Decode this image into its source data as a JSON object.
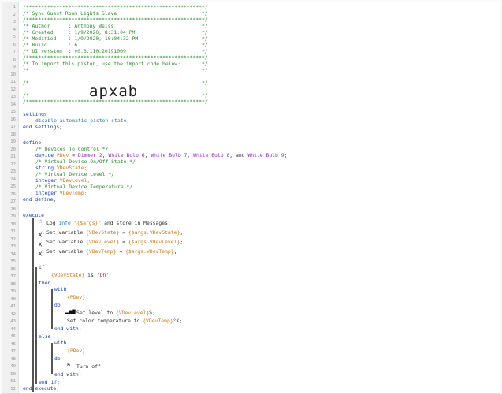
{
  "code": {
    "header": [
      "/***********************************************************/",
      "/* Sync Guest Room Lights Slave                            */",
      "/***********************************************************/",
      "/* Author      : Anthony Weiss                             */",
      "/* Created     : 1/9/2020, 8:31:04 PM                      */",
      "/* Modified    : 1/9/2020, 10:04:32 PM                     */",
      "/* Build       : 6                                         */",
      "/* UI version  : v0.3.110.20191009                         */",
      "/***********************************************************/",
      "/* To import this piston, use the import code below:       */",
      "/*                                                         */",
      "/*                                                         */",
      "/*                                                         */",
      "/***********************************************************/"
    ],
    "import_code": "apxab",
    "settings": {
      "kw_open": "settings",
      "statement": "disable automatic piston state;",
      "kw_close": "end settings;"
    },
    "define": {
      "kw_open": "define",
      "c_devices": "/* Devices To Control */",
      "device_kw": "device",
      "device_name": "PDev",
      "device_eq": " = ",
      "d1": "Dimmer 2",
      "d2": "White Bulb 6",
      "d3": "White Bulb 7",
      "d4": "White Bulb 8",
      "d5": "White Bulb 9",
      "sep_comma": ", ",
      "sep_and": ", and ",
      "semi": ";",
      "c_state": "/* Virtual Device On/Off State */",
      "string_kw": "string",
      "state_var": "VDevState;",
      "c_level": "/* Virtual Device Level */",
      "int_kw": "integer",
      "level_var": "VDevLevel;",
      "c_temp": "/* Virtual Device Temperature */",
      "int_kw2": "integer",
      "temp_var": "VDevTemp;",
      "kw_close": "end define;"
    },
    "execute": {
      "kw_open": "execute",
      "log_pre": "Log ",
      "log_level": "info",
      "log_str": " \"{$args}\"",
      "log_post": " and store in Messages;",
      "set_pre": "Set variable ",
      "set1_var": "{VDevState}",
      "set1_val": "{$args.VDevState}",
      "set2_var": "{VDevLevel}",
      "set2_val": "{$args.VDevLevel}",
      "set3_var": "{VDevTemp}",
      "set3_val": "{$args.VDevTemp}",
      "eq": " = ",
      "semi": ";",
      "if_kw": "if",
      "cond_var": "{VDevState}",
      "cond_is": " is ",
      "cond_val": "'On'",
      "then_kw": "then",
      "with_kw": "with",
      "pdev": "{PDev}",
      "do_kw": "do",
      "level_pre": "Set level to ",
      "level_var": "{VDevLevel}",
      "level_post": "%;",
      "temp_pre": "Set color temperature to ",
      "temp_var": "{VDevTemp}",
      "temp_post": "°K;",
      "end_with": "end with;",
      "else_kw": "else",
      "with_kw2": "with",
      "pdev2": "{PDev}",
      "do_kw2": "do",
      "turn_off": "Turn off;",
      "end_with2": "end with;",
      "end_if": "end if;",
      "kw_close": "end execute;"
    }
  },
  "icons": {
    "log": "hand-pointer-icon",
    "set": "variable-x-icon",
    "set_label": "X",
    "set_sup": "1",
    "level": "signal-bars-icon",
    "power": "power-icon"
  }
}
